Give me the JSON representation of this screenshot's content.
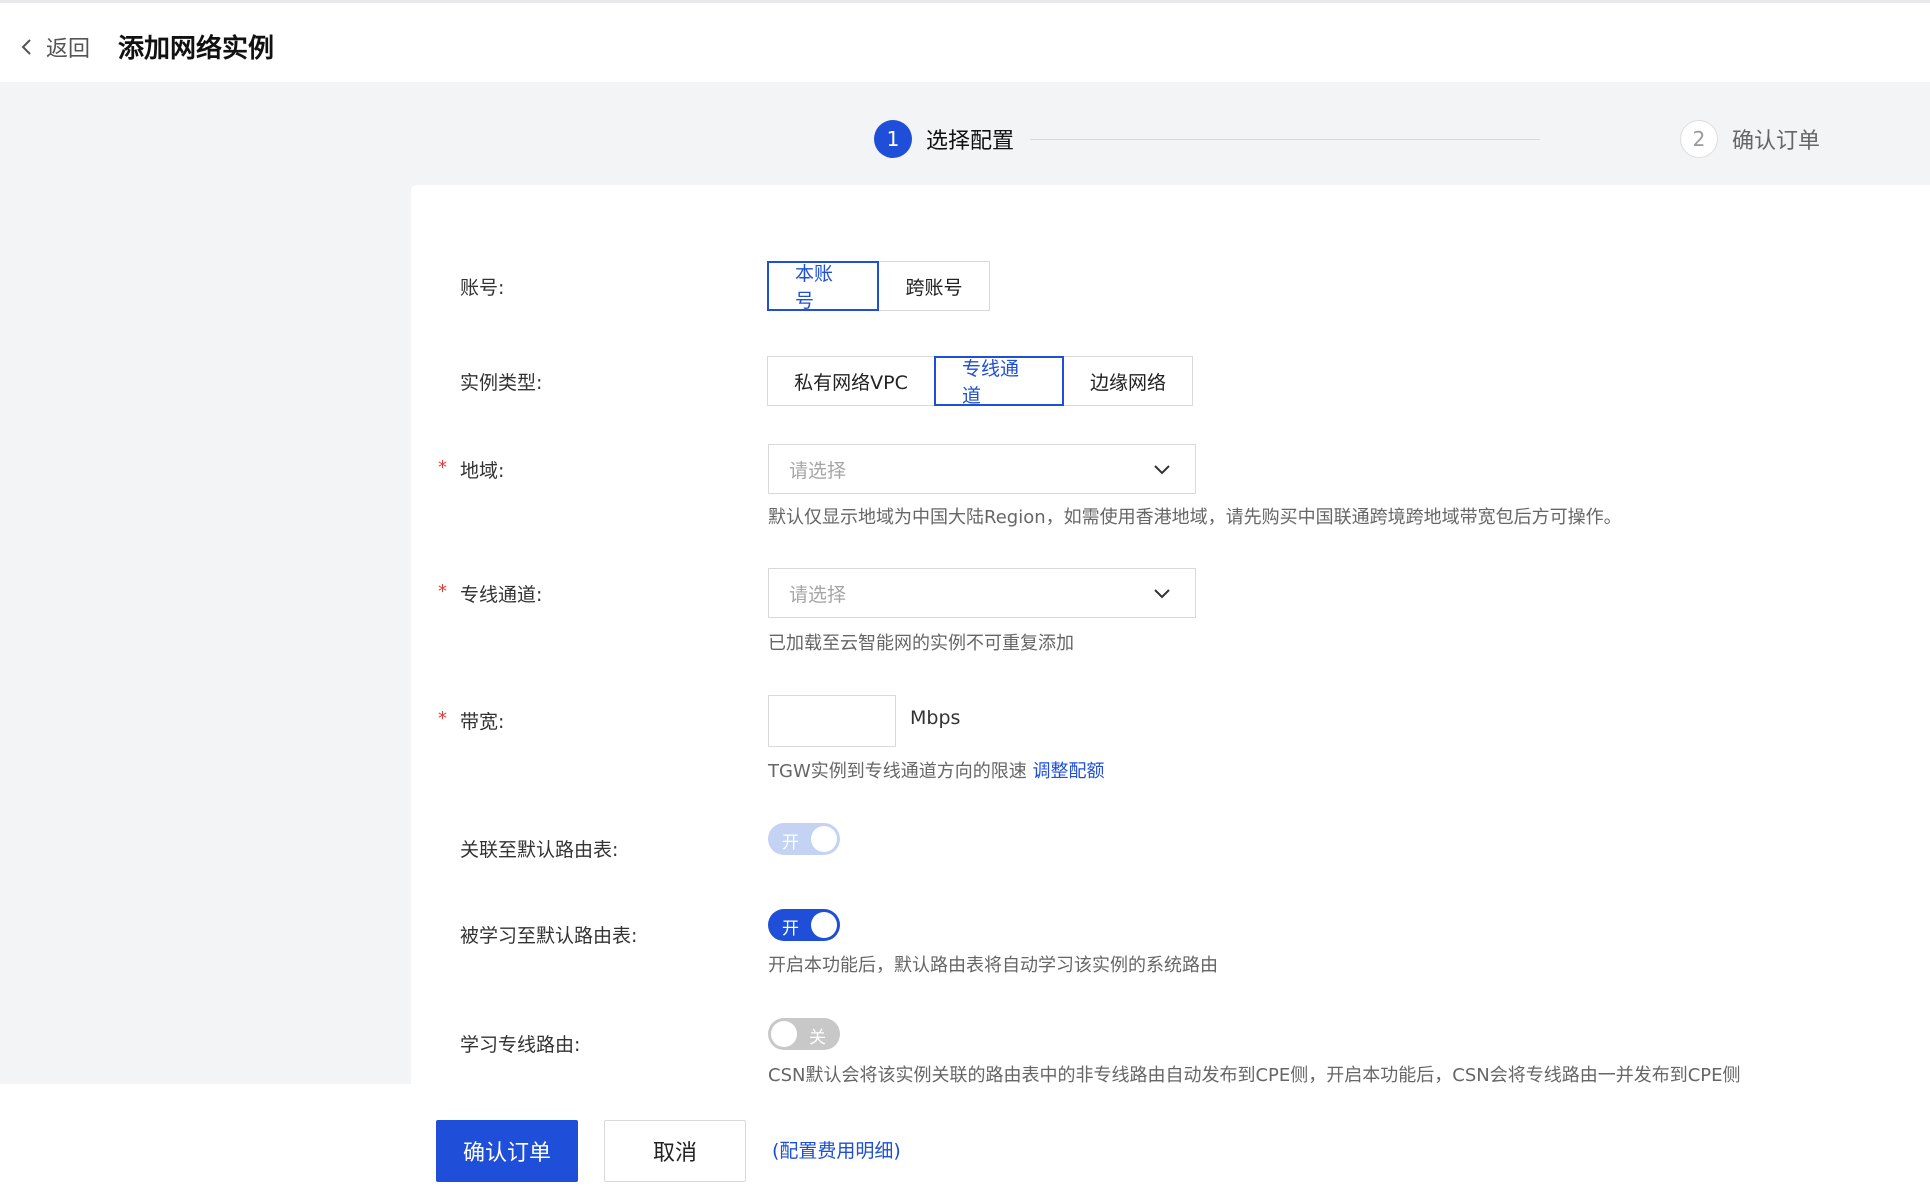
{
  "header": {
    "back_label": "返回",
    "title": "添加网络实例"
  },
  "steps": [
    {
      "number": "1",
      "label": "选择配置"
    },
    {
      "number": "2",
      "label": "确认订单"
    }
  ],
  "form": {
    "account": {
      "label": "账号:",
      "options": [
        "本账号",
        "跨账号"
      ],
      "selected": "本账号"
    },
    "instance_type": {
      "label": "实例类型:",
      "options": [
        "私有网络VPC",
        "专线通道",
        "边缘网络"
      ],
      "selected": "专线通道"
    },
    "region": {
      "required_mark": "*",
      "label": "地域:",
      "placeholder": "请选择",
      "help": "默认仅显示地域为中国大陆Region，如需使用香港地域，请先购买中国联通跨境跨地域带宽包后方可操作。"
    },
    "direct_connect": {
      "required_mark": "*",
      "label": "专线通道:",
      "placeholder": "请选择",
      "help": "已加载至云智能网的实例不可重复添加"
    },
    "bandwidth": {
      "required_mark": "*",
      "label": "带宽:",
      "value": "",
      "unit": "Mbps",
      "help": "TGW实例到专线通道方向的限速",
      "help_link": "调整配额"
    },
    "associate_default_route": {
      "label": "关联至默认路由表:",
      "state": "开"
    },
    "learned_by_default_route": {
      "label": "被学习至默认路由表:",
      "state": "开",
      "help": "开启本功能后，默认路由表将自动学习该实例的系统路由"
    },
    "learn_dc_route": {
      "label": "学习专线路由:",
      "state": "关",
      "help": "CSN默认会将该实例关联的路由表中的非专线路由自动发布到CPE侧，开启本功能后，CSN会将专线路由一并发布到CPE侧"
    }
  },
  "footer": {
    "confirm_label": "确认订单",
    "cancel_label": "取消",
    "fee_link": "(配置费用明细)"
  },
  "colors": {
    "accent": "#1f4fd8",
    "required": "#e53935",
    "page_bg": "#f3f4f6"
  }
}
